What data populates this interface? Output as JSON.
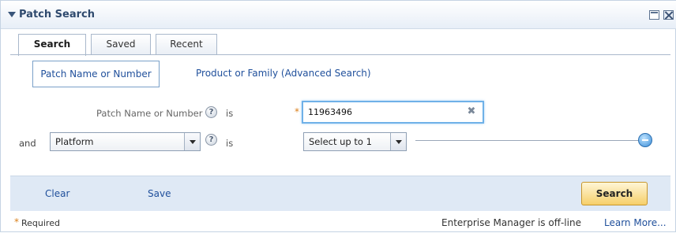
{
  "header": {
    "title": "Patch Search"
  },
  "tabs": [
    {
      "label": "Search"
    },
    {
      "label": "Saved"
    },
    {
      "label": "Recent"
    }
  ],
  "modes": {
    "basic_label": "Patch Name or Number",
    "advanced_label": "Product or Family (Advanced Search)"
  },
  "form": {
    "row1": {
      "label": "Patch Name or Number",
      "help_glyph": "?",
      "operator": "is",
      "required_mark": "*",
      "value": "11963496",
      "clear_glyph": "✖"
    },
    "row2": {
      "conjunction": "and",
      "field_selected": "Platform",
      "help_glyph": "?",
      "operator": "is",
      "value_selected": "Select up to 1"
    }
  },
  "actions": {
    "clear_label": "Clear",
    "save_label": "Save",
    "search_label": "Search"
  },
  "footer": {
    "required_mark": "*",
    "required_label": "Required",
    "status": "Enterprise Manager is off-line",
    "learn_more": "Learn More..."
  },
  "colors": {
    "accent": "#1f4f9b",
    "required": "#d97f1a",
    "action_bar": "#dfe9f5",
    "search_button": "#f6cf6a"
  }
}
